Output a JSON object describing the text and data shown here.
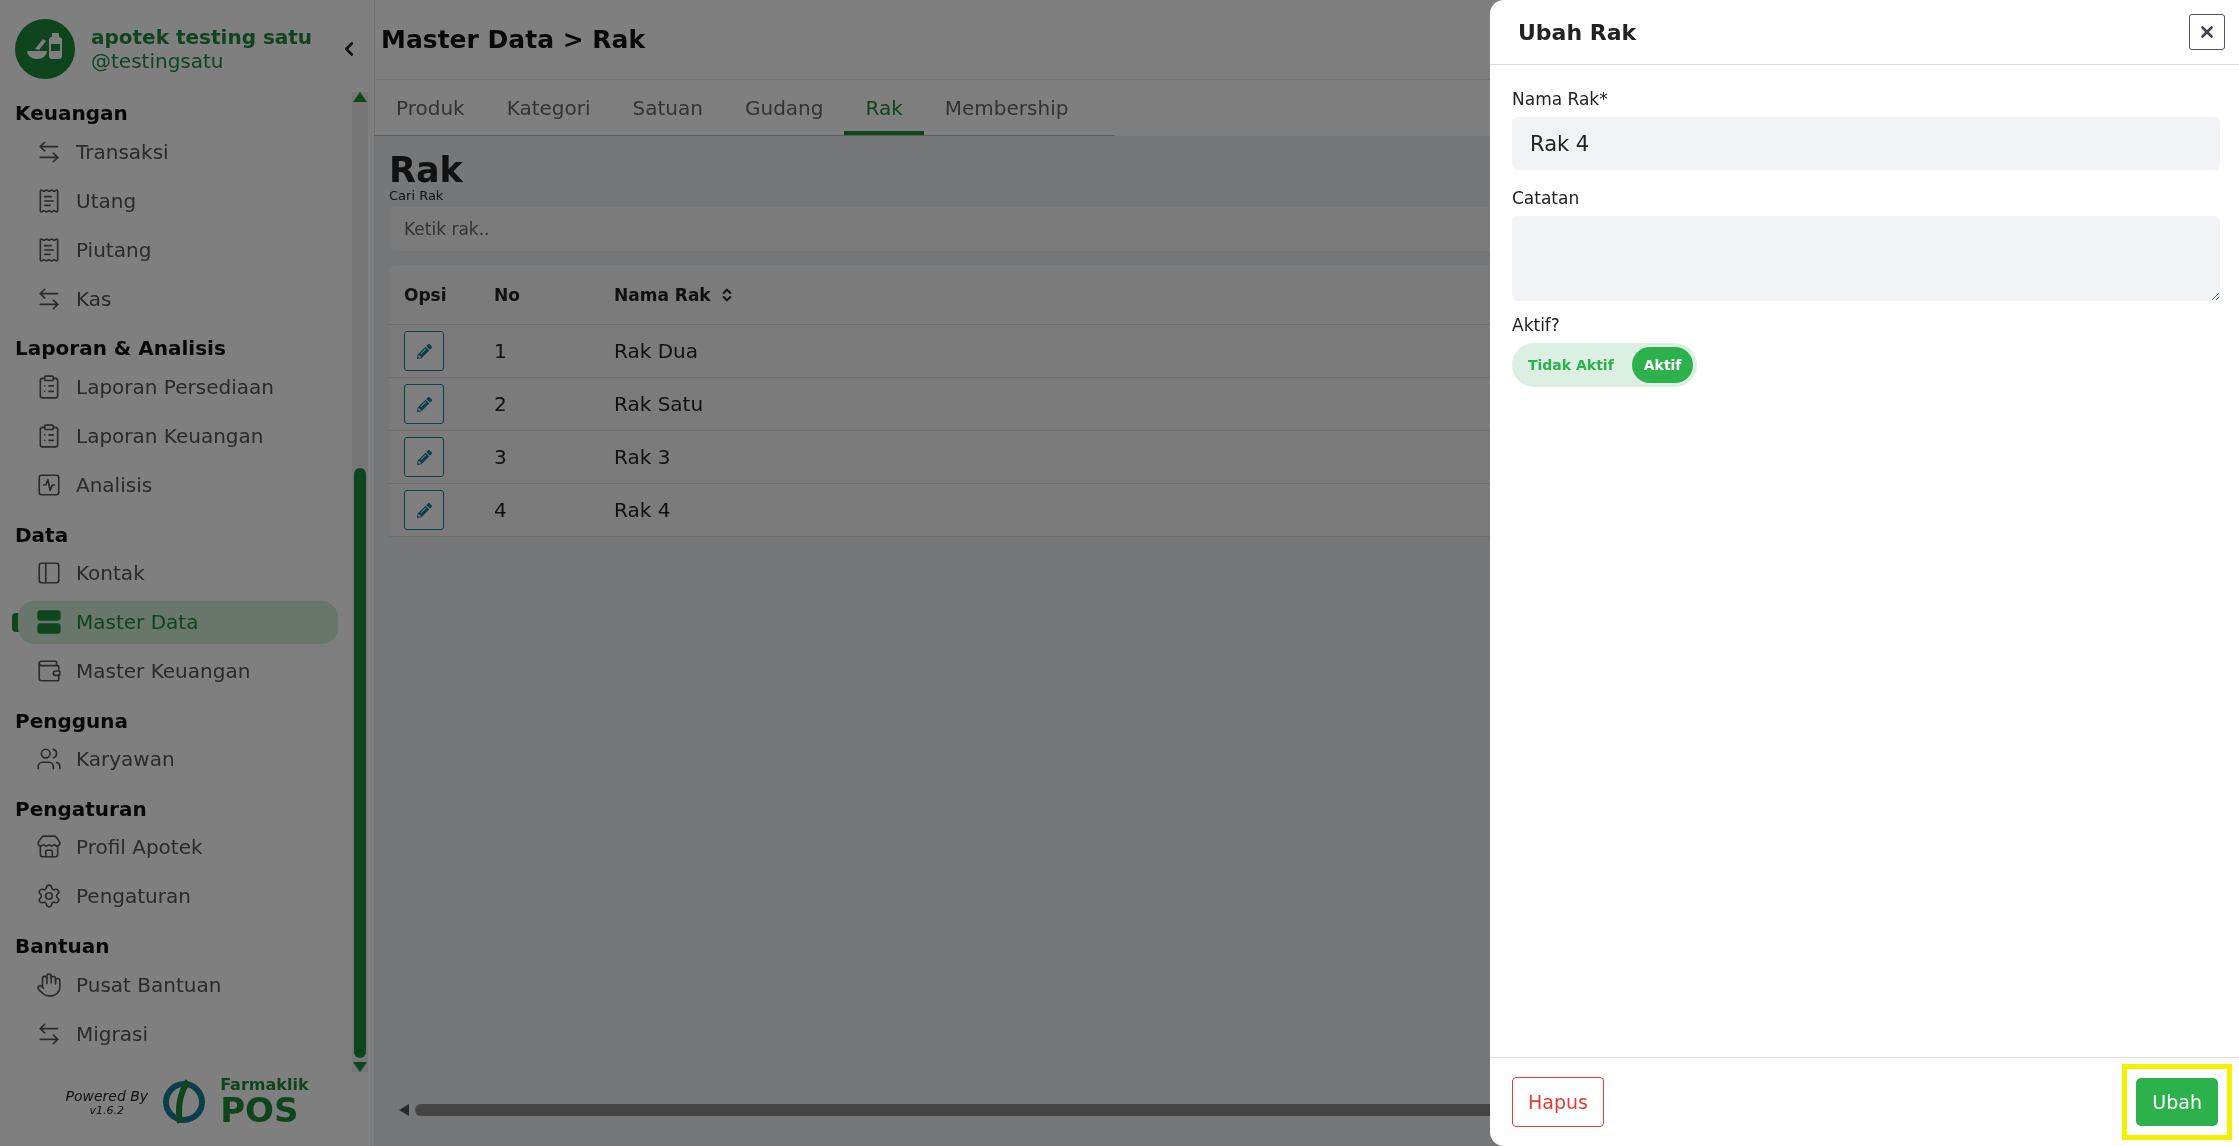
{
  "sidebar": {
    "pharmacy_name": "apotek testing satu",
    "username": "@testingsatu",
    "sections": [
      {
        "title": "Keuangan",
        "items": [
          {
            "label": "Transaksi",
            "selected": false
          },
          {
            "label": "Utang",
            "selected": false
          },
          {
            "label": "Piutang",
            "selected": false
          },
          {
            "label": "Kas",
            "selected": false
          }
        ]
      },
      {
        "title": "Laporan & Analisis",
        "items": [
          {
            "label": "Laporan Persediaan",
            "selected": false
          },
          {
            "label": "Laporan Keuangan",
            "selected": false
          },
          {
            "label": "Analisis",
            "selected": false
          }
        ]
      },
      {
        "title": "Data",
        "items": [
          {
            "label": "Kontak",
            "selected": false
          },
          {
            "label": "Master Data",
            "selected": true
          },
          {
            "label": "Master Keuangan",
            "selected": false
          }
        ]
      },
      {
        "title": "Pengguna",
        "items": [
          {
            "label": "Karyawan",
            "selected": false
          }
        ]
      },
      {
        "title": "Pengaturan",
        "items": [
          {
            "label": "Profil Apotek",
            "selected": false
          },
          {
            "label": "Pengaturan",
            "selected": false
          }
        ]
      },
      {
        "title": "Bantuan",
        "items": [
          {
            "label": "Pusat Bantuan",
            "selected": false
          },
          {
            "label": "Migrasi",
            "selected": false
          }
        ]
      }
    ],
    "footer": {
      "powered_by": "Powered By",
      "version": "v1.6.2",
      "brand_top": "Farmaklik",
      "brand_bottom": "POS"
    }
  },
  "page": {
    "breadcrumb": "Master Data > Rak",
    "tabs": [
      {
        "label": "Produk",
        "selected": false
      },
      {
        "label": "Kategori",
        "selected": false
      },
      {
        "label": "Satuan",
        "selected": false
      },
      {
        "label": "Gudang",
        "selected": false
      },
      {
        "label": "Rak",
        "selected": true
      },
      {
        "label": "Membership",
        "selected": false
      }
    ],
    "heading": "Rak",
    "search": {
      "label": "Cari Rak",
      "placeholder": "Ketik rak.."
    },
    "table": {
      "columns": [
        "Opsi",
        "No",
        "Nama Rak"
      ],
      "rows": [
        {
          "no": "1",
          "name": "Rak Dua"
        },
        {
          "no": "2",
          "name": "Rak Satu"
        },
        {
          "no": "3",
          "name": "Rak 3"
        },
        {
          "no": "4",
          "name": "Rak 4"
        }
      ]
    }
  },
  "drawer": {
    "title": "Ubah Rak",
    "name_label": "Nama Rak*",
    "name_value": "Rak 4",
    "notes_label": "Catatan",
    "active_label": "Aktif?",
    "active_options": [
      {
        "label": "Tidak Aktif",
        "selected": false
      },
      {
        "label": "Aktif",
        "selected": true
      }
    ],
    "delete_button": "Hapus",
    "submit_button": {
      "label": "Ubah",
      "highlighted": true
    }
  }
}
